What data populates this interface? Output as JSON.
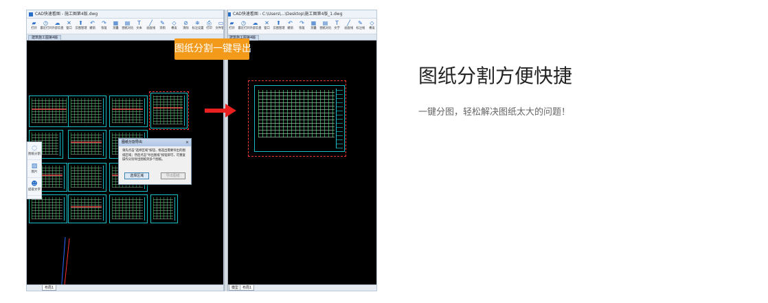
{
  "left_window": {
    "title": "CAD快速看图 - 施工图第4版.dwg",
    "doc_tab": "建筑施工图第4版",
    "layout_tab": "布局1",
    "toolbar": [
      {
        "icon": "open-icon",
        "label": "打开"
      },
      {
        "icon": "recent-icon",
        "label": "最近打开"
      },
      {
        "icon": "cloud-icon",
        "label": "外部云盘"
      },
      {
        "icon": "close-icon",
        "label": "窗口"
      },
      {
        "icon": "upload-icon",
        "label": "云图管理"
      },
      {
        "icon": "undo-icon",
        "label": "撤销"
      },
      {
        "icon": "redo-icon",
        "label": "恢复"
      },
      {
        "icon": "measure-icon",
        "label": "测量"
      },
      {
        "icon": "compare-icon",
        "label": "图纸对比"
      },
      {
        "icon": "text-icon",
        "label": "文本"
      },
      {
        "icon": "line-icon",
        "label": "画直线"
      },
      {
        "icon": "pen-icon",
        "label": "涂鸦"
      },
      {
        "icon": "eraser-icon",
        "label": "橡皮"
      },
      {
        "icon": "clear-icon",
        "label": "清除"
      },
      {
        "icon": "layer-icon",
        "label": "标注设置"
      },
      {
        "icon": "print-icon",
        "label": "打印"
      },
      {
        "icon": "doc-icon",
        "label": "文件管理"
      }
    ],
    "side_panel": [
      {
        "icon": "split-icon",
        "label": "图纸分割"
      },
      {
        "icon": "image-icon",
        "label": "图片"
      },
      {
        "icon": "user-icon",
        "label": "提取文字"
      }
    ],
    "dialog": {
      "title": "图纸分割导出",
      "body": "请先点击\"选择区域\"按钮，框选出需要导出的图纸区域；然后点击\"导出图纸\"按钮即可，可重复操作分别导出图纸到多个图纸。",
      "primary_button": "选择区域",
      "secondary_button": "导出图纸"
    }
  },
  "right_window": {
    "title": "CAD快速看图 - C:\\Users\\...\\Desktop\\施工图第4版_1.dwg",
    "doc_tab": "建筑施工图第4版",
    "model_tab": "模型",
    "layout_tab": "布局1",
    "toolbar": [
      {
        "icon": "open-icon",
        "label": "打开"
      },
      {
        "icon": "recent-icon",
        "label": "最近打开"
      },
      {
        "icon": "cloud-icon",
        "label": "外部云盘"
      },
      {
        "icon": "close-icon",
        "label": "窗口"
      },
      {
        "icon": "upload-icon",
        "label": "云图管理"
      },
      {
        "icon": "undo-icon",
        "label": "撤销"
      },
      {
        "icon": "redo-icon",
        "label": "恢复"
      },
      {
        "icon": "measure-icon",
        "label": "测量"
      },
      {
        "icon": "compare-icon",
        "label": "图纸对比"
      },
      {
        "icon": "text-icon",
        "label": "文字"
      },
      {
        "icon": "line-icon",
        "label": "画直线"
      },
      {
        "icon": "pen-icon",
        "label": "标注线"
      },
      {
        "icon": "eraser-icon",
        "label": "橡皮"
      },
      {
        "icon": "clear-icon",
        "label": "清除"
      }
    ]
  },
  "badge": "图纸分割一键导出",
  "headline": "图纸分割方便快捷",
  "subline": "一键分图，轻松解决图纸太大的问题！",
  "colors": {
    "badge": "#f39a1b",
    "arrow": "#e8201f",
    "selection": "#ff3b30",
    "blueprint": "#18c0c8"
  }
}
